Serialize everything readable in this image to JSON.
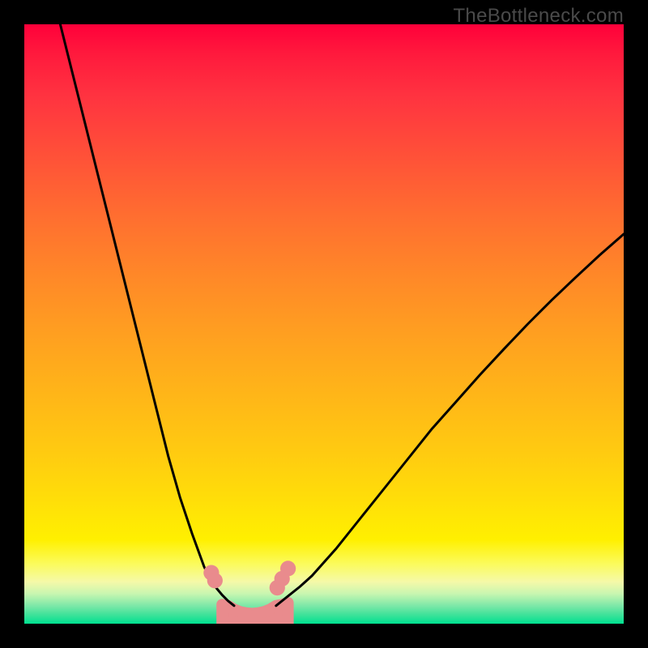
{
  "watermark": "TheBottleneck.com",
  "chart_data": {
    "type": "line",
    "title": "",
    "xlabel": "",
    "ylabel": "",
    "xlim": [
      0,
      100
    ],
    "ylim": [
      0,
      100
    ],
    "grid": false,
    "series": [
      {
        "name": "left-curve",
        "color": "#000000",
        "x": [
          6,
          8,
          10,
          12,
          14,
          16,
          18,
          20,
          22,
          24,
          26,
          28,
          30,
          31,
          32,
          33,
          34,
          35
        ],
        "y": [
          100,
          92,
          84,
          76,
          68,
          60,
          52,
          44,
          36,
          28,
          21,
          15,
          9.5,
          7.5,
          6,
          4.8,
          3.8,
          3.0
        ]
      },
      {
        "name": "right-curve",
        "color": "#000000",
        "x": [
          42,
          43,
          44,
          46,
          48,
          52,
          56,
          60,
          64,
          68,
          72,
          76,
          80,
          84,
          88,
          92,
          96,
          100
        ],
        "y": [
          3.0,
          3.8,
          4.6,
          6.2,
          8.0,
          12.5,
          17.5,
          22.5,
          27.5,
          32.5,
          37.0,
          41.5,
          45.8,
          50.0,
          54.0,
          57.8,
          61.5,
          65.0
        ]
      },
      {
        "name": "bottom-fill",
        "color": "#e98b8d",
        "type": "area",
        "x": [
          33,
          34,
          35,
          36,
          37,
          38,
          39,
          40,
          41,
          42,
          43,
          44
        ],
        "y": [
          3.2,
          3.0,
          2.4,
          2.0,
          1.8,
          1.7,
          1.8,
          2.0,
          2.4,
          3.0,
          3.2,
          3.5
        ]
      }
    ],
    "markers": [
      {
        "x": 31.2,
        "y": 8.5,
        "color": "#e98b8d",
        "r": 1.3
      },
      {
        "x": 31.8,
        "y": 7.2,
        "color": "#e98b8d",
        "r": 1.3
      },
      {
        "x": 42.2,
        "y": 6.0,
        "color": "#e98b8d",
        "r": 1.3
      },
      {
        "x": 43.0,
        "y": 7.5,
        "color": "#e98b8d",
        "r": 1.3
      },
      {
        "x": 44.0,
        "y": 9.2,
        "color": "#e98b8d",
        "r": 1.3
      }
    ]
  }
}
